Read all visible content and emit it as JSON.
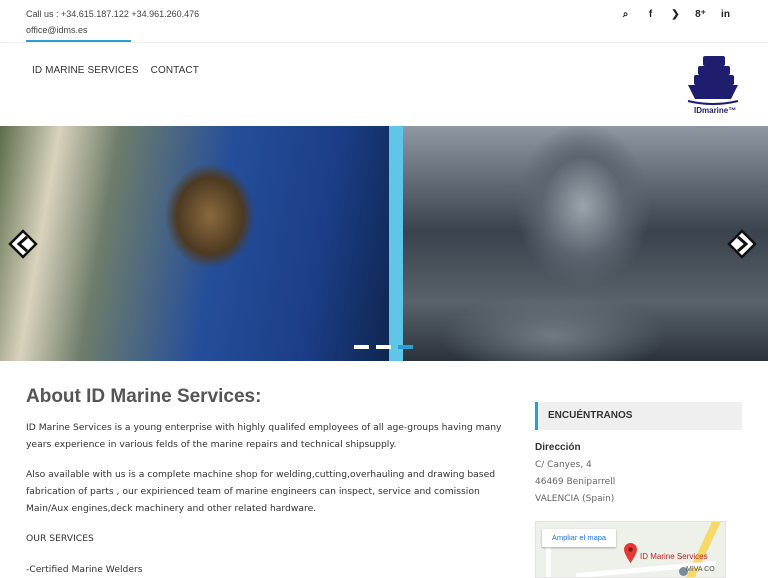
{
  "topbar": {
    "phone": "Call us : +34.615.187.122 +34.961.260.476",
    "email": "office@idms.es",
    "social_icons": [
      "search-icon",
      "facebook-icon",
      "twitter-icon",
      "google-plus-icon",
      "linkedin-icon"
    ],
    "social_glyphs": [
      "⌕",
      "f",
      "❯",
      "8⁺",
      "in"
    ]
  },
  "nav": {
    "items": [
      "ID MARINE SERVICES",
      "CONTACT"
    ]
  },
  "logo": {
    "text": "IDmarine™",
    "color": "#1f1e6e"
  },
  "slider": {
    "slide_count": 3,
    "active_slide": 3,
    "accent": "#2a9fd6"
  },
  "about": {
    "title": "About ID Marine Services:",
    "p1": "ID Marine Services is a young enterprise with highly qualifed employees of all age-groups having many years experience in various felds of the marine repairs and technical shipsupply.",
    "p2": "Also available with us is a complete machine shop for welding,cutting,overhauling and drawing based fabrication of parts , our expirienced team of marine engineers can inspect, service and comission Main/Aux engines,deck machinery and other related hardware.",
    "p3": "OUR SERVICES",
    "p4": "-Certified Marine Welders"
  },
  "sidebar": {
    "widget_title": "ENCUÉNTRANOS",
    "direction_label": "Dirección",
    "address_lines": [
      "C/ Canyes, 4",
      "46469  Beniparrell",
      "VALENCIA  (Spain)"
    ],
    "map": {
      "button_label": "Ampliar el mapa",
      "place_name": "ID Marine Services",
      "nearby": "MIVA CO"
    }
  }
}
